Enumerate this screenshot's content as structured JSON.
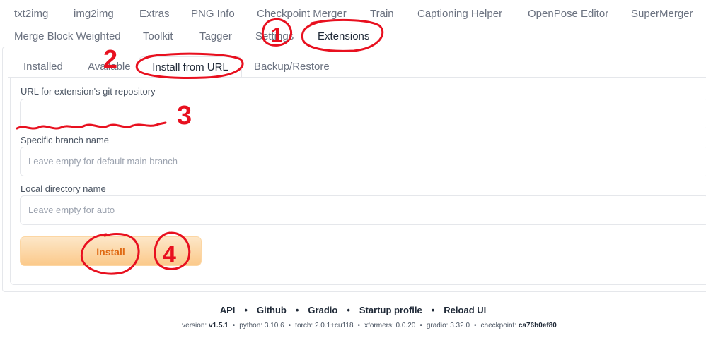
{
  "top_tabs": [
    "txt2img",
    "img2img",
    "Extras",
    "PNG Info",
    "Checkpoint Merger",
    "Train",
    "Captioning Helper",
    "OpenPose Editor",
    "SuperMerger",
    "Merge Block Weighted",
    "Toolkit",
    "Tagger",
    "Settings",
    "Extensions"
  ],
  "sub_tabs": [
    "Installed",
    "Available",
    "Install from URL",
    "Backup/Restore"
  ],
  "form": {
    "url_label": "URL for extension's git repository",
    "url_value": "",
    "branch_label": "Specific branch name",
    "branch_placeholder": "Leave empty for default main branch",
    "dir_label": "Local directory name",
    "dir_placeholder": "Leave empty for auto",
    "install_label": "Install"
  },
  "footer": {
    "links": [
      "API",
      "Github",
      "Gradio",
      "Startup profile",
      "Reload UI"
    ],
    "version_label": "version:",
    "version": "v1.5.1",
    "python": "python: 3.10.6",
    "torch": "torch: 2.0.1+cu118",
    "xformers": "xformers: 0.0.20",
    "gradio": "gradio: 3.32.0",
    "checkpoint_label": "checkpoint:",
    "checkpoint": "ca76b0ef80"
  },
  "annotations": [
    "1",
    "2",
    "3",
    "4"
  ],
  "colors": {
    "annotation": "#e8101f",
    "install_text": "#e06a14",
    "install_bg": "#fbc98a"
  }
}
